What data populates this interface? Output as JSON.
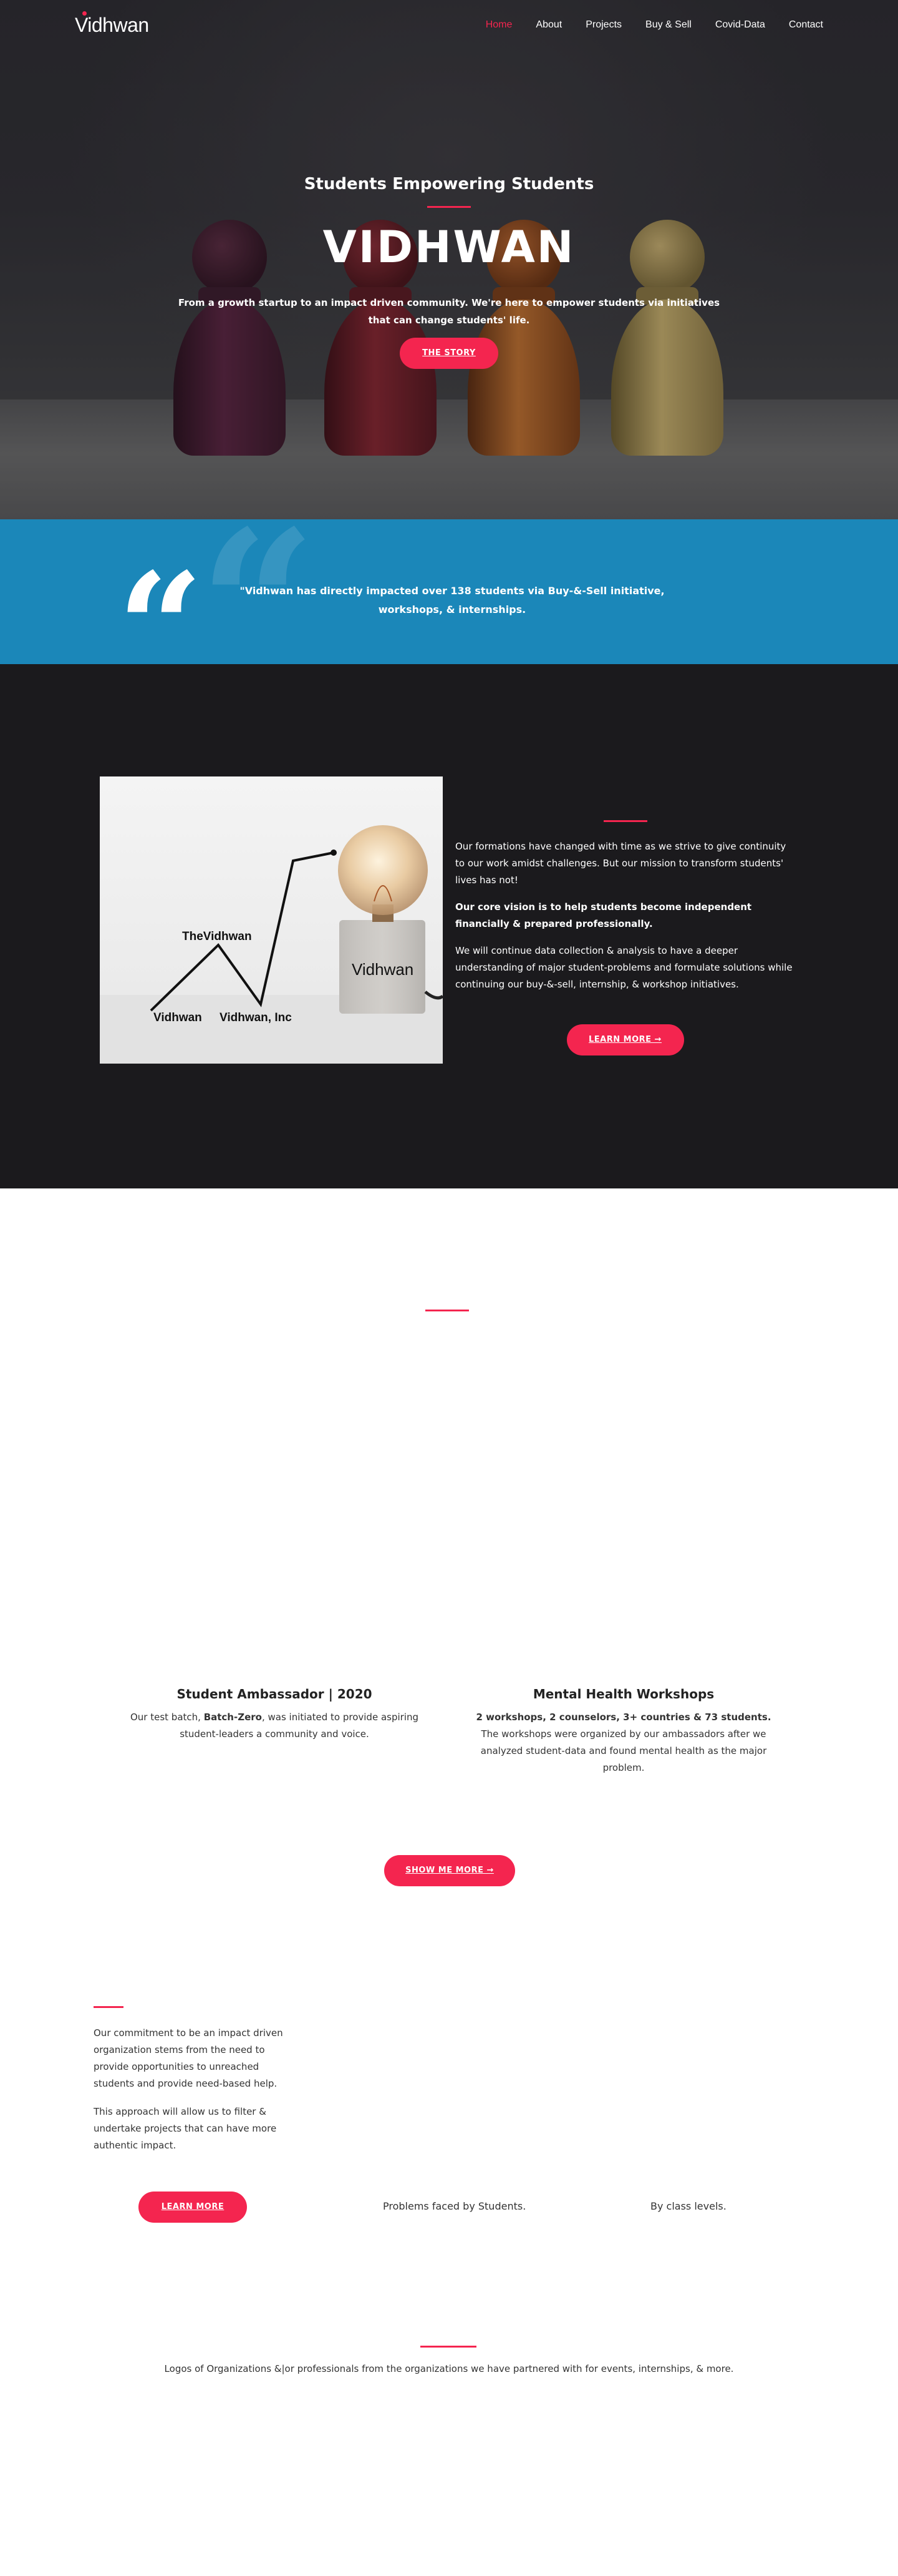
{
  "nav": {
    "logo": "Vidhwan",
    "links": [
      "Home",
      "About",
      "Projects",
      "Buy & Sell",
      "Covid-Data",
      "Contact"
    ]
  },
  "hero": {
    "subtitle": "Students Empowering Students",
    "title": "VIDHWAN",
    "text": "From a growth startup to an impact driven community. We're here to empower students via initiatives that can change students' life.",
    "button": "THE STORY"
  },
  "quote": {
    "text": "\"Vidhwan has directly impacted over 138 students via Buy-&-Sell initiative, workshops, & internships."
  },
  "about": {
    "image_labels": [
      "TheVidhwan",
      "Vidhwan",
      "Vidhwan, Inc",
      "Vidhwan"
    ],
    "p1": "Our formations have changed with time as we strive to give continuity to our work amidst challenges. But our mission to transform students' lives has not!",
    "p2": "Our core vision is to help students become independent financially & prepared professionally.",
    "p3": "We will continue data collection & analysis to have a deeper understanding of major student-problems and formulate solutions while continuing our buy-&-sell, internship, & workshop initiatives.",
    "button": "LEARN MORE →"
  },
  "projects": {
    "cards": [
      {
        "title": "Student Ambassador | 2020",
        "text_before": "Our test batch, ",
        "text_bold": "Batch-Zero",
        "text_after": ", was initiated to provide aspiring student-leaders a community and voice."
      },
      {
        "title": "Mental Health Workshops",
        "text_bold": "2 workshops, 2 counselors, 3+ countries & 73 students.",
        "text_after": "The workshops were organized by our ambassadors after we analyzed student-data and found mental health as the major problem."
      }
    ],
    "button": "SHOW ME MORE →"
  },
  "commitment": {
    "p1": "Our commitment to be an impact driven organization stems from the need to provide opportunities to unreached students and provide need-based help.",
    "p2": "This approach will allow us to filter & undertake projects that can have more authentic impact.",
    "button": "LEARN MORE",
    "caption_1": "Problems faced by Students.",
    "caption_2": "By class levels."
  },
  "partners": {
    "text": "Logos of Organizations &|or professionals from the organizations we have partnered with for events, internships, & more."
  },
  "colors": {
    "accent": "#f4254f",
    "quote_band": "#1b87b9",
    "dark_section": "#1b1a1d"
  }
}
